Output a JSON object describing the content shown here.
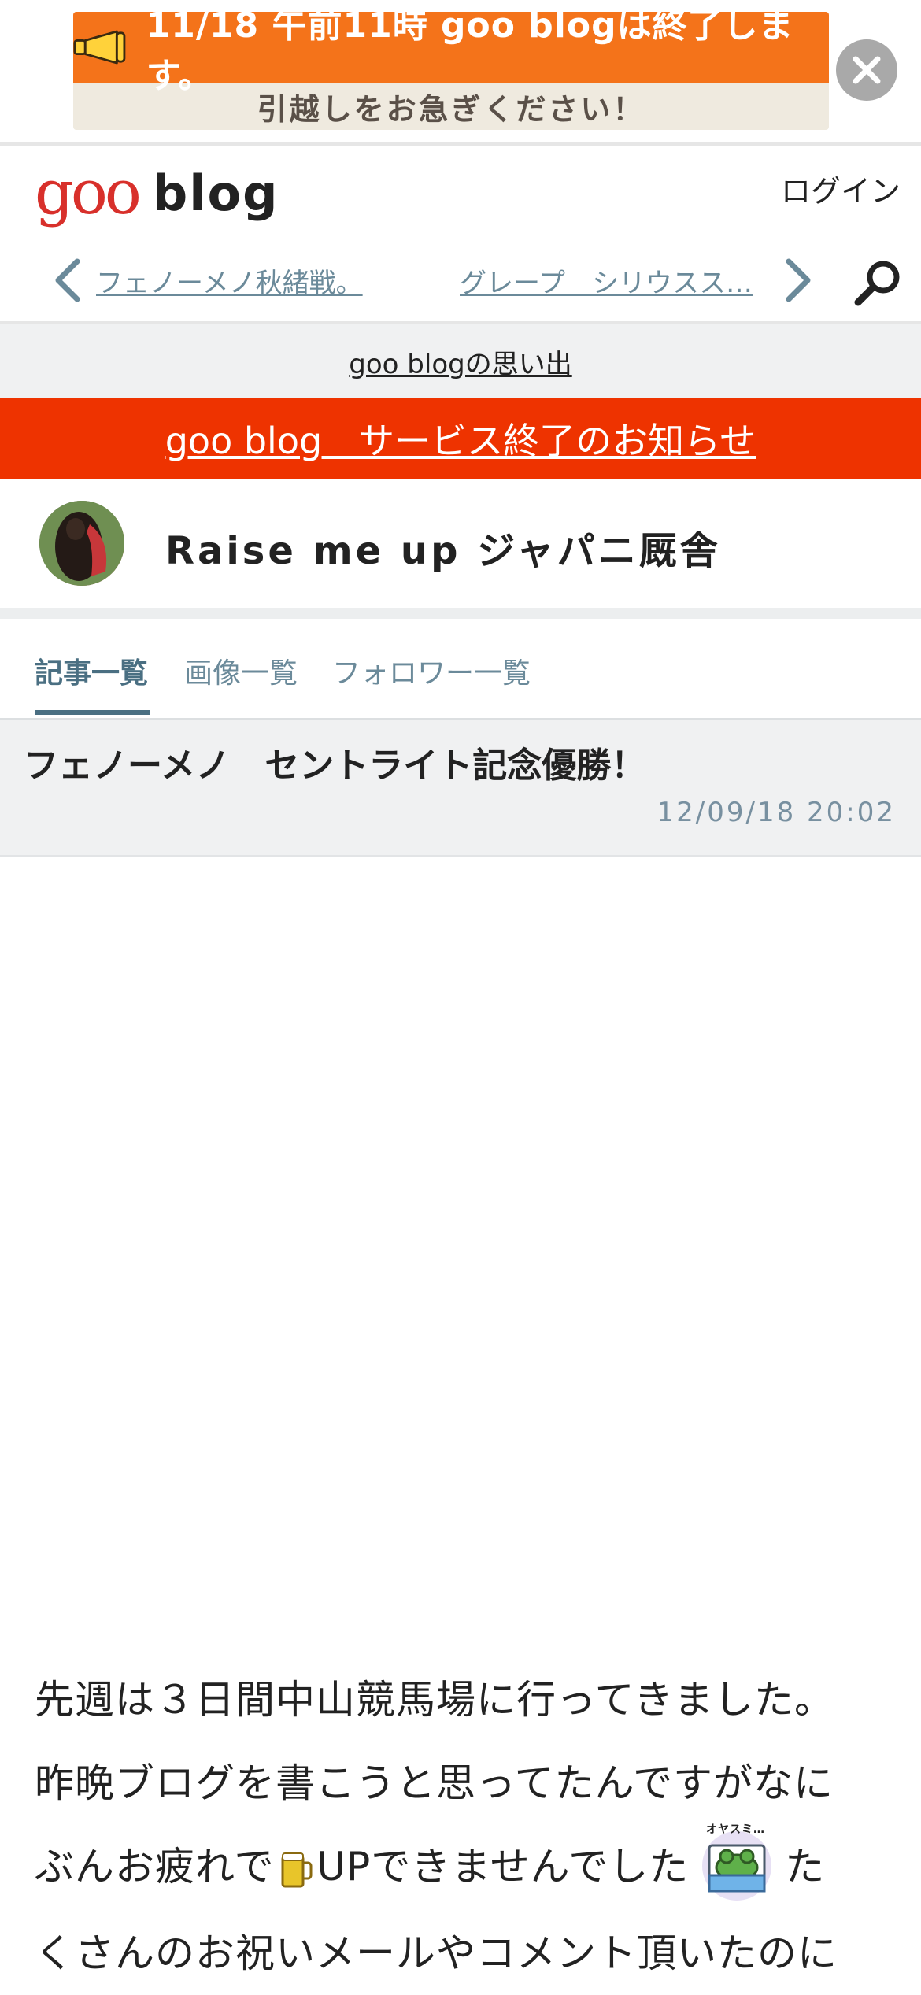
{
  "banner": {
    "line1": "11/18 午前11時 goo blogは終了します。",
    "line2": "引越しをお急ぎください！",
    "top_color": "#f4731a",
    "bottom_color": "#efeadf"
  },
  "header": {
    "logo_goo": "goo",
    "logo_blog": "blog",
    "login_label": "ログイン"
  },
  "nav": {
    "prev_label": "フェノーメノ秋緒戦。",
    "next_label": "グレープ　シリウスス…"
  },
  "memories_link": "goo blogの思い出",
  "notice": {
    "label": "goo blog　サービス終了のお知らせ",
    "color": "#ee3300"
  },
  "blog": {
    "name": "Raise me up ジャパニ厩舎"
  },
  "tabs": [
    {
      "label": "記事一覧",
      "active": true
    },
    {
      "label": "画像一覧",
      "active": false
    },
    {
      "label": "フォロワー一覧",
      "active": false
    }
  ],
  "article": {
    "title": "フェノーメノ　セントライト記念優勝！",
    "date": "12/09/18 20:02",
    "body": {
      "line1": "先週は３日間中山競馬場に行ってきました。",
      "line2": "昨晩ブログを書こうと思ってたんですがなに",
      "line3a": "ぶんお疲れで",
      "line3b": "UPできませんでした",
      "line3c": "た",
      "line4": "くさんのお祝いメールやコメント頂いたのに",
      "frog_caption": "オヤスミ…"
    }
  },
  "icons": {
    "close": "close-icon",
    "prev": "chevron-left-icon",
    "next": "chevron-right-icon",
    "search": "search-icon",
    "megaphone": "megaphone-icon",
    "beer": "beer-icon",
    "frog": "sleeping-frog-icon"
  },
  "colors": {
    "accent": "#4a6f82",
    "link": "#6b8a9a",
    "brand_red": "#d8302b"
  }
}
